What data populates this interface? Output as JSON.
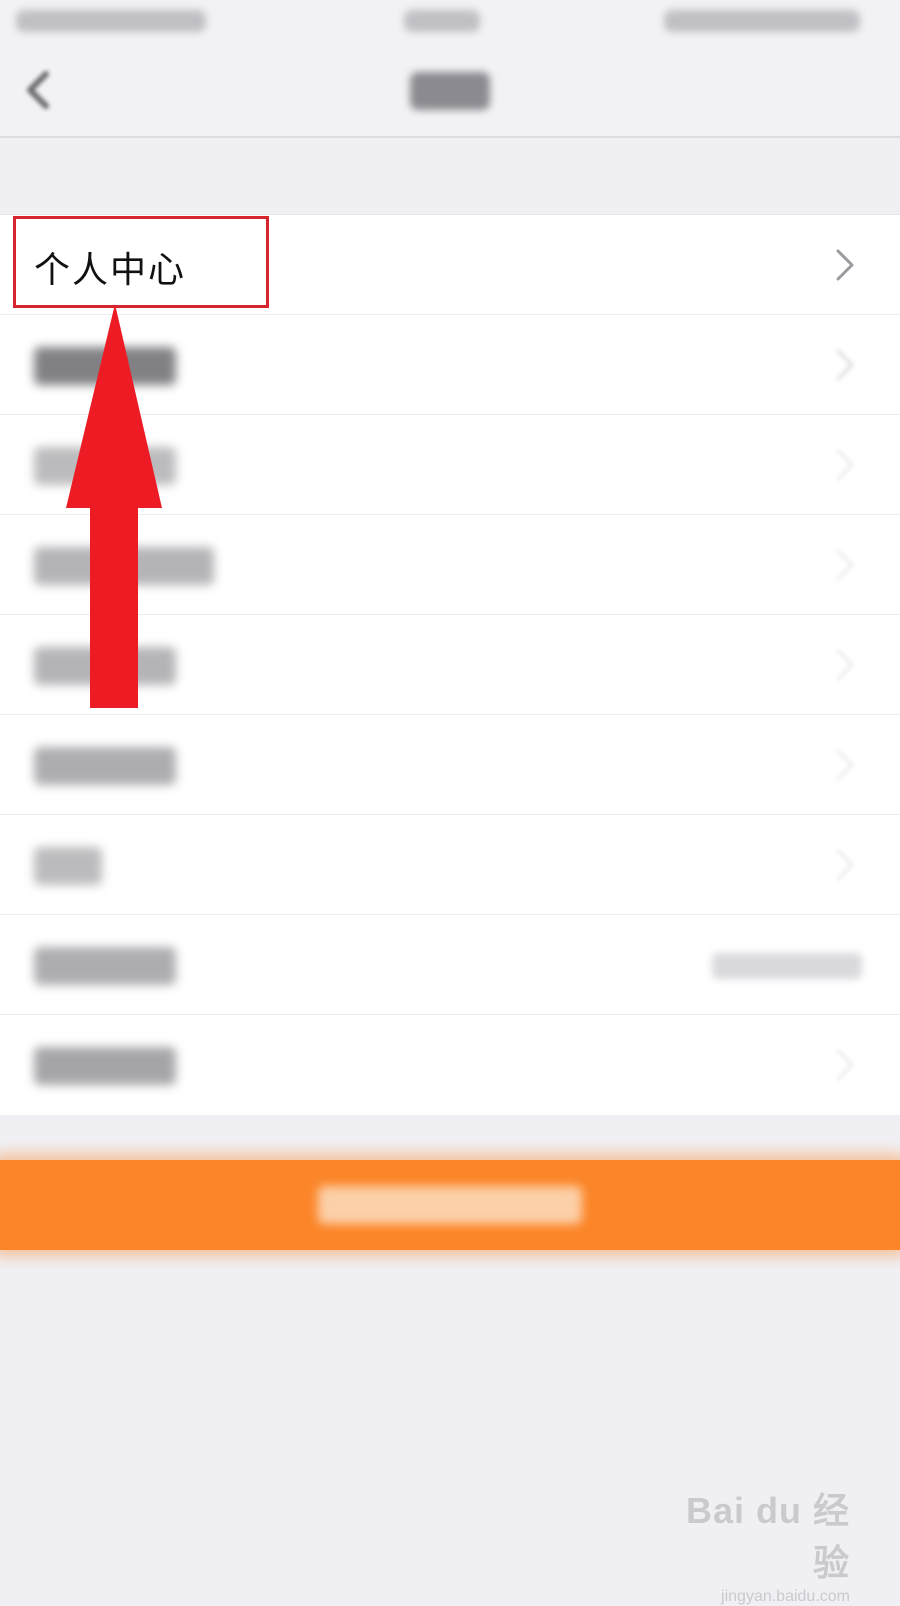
{
  "nav": {
    "back_icon": "chevron-left-icon"
  },
  "menu": {
    "items": [
      {
        "label": "个人中心",
        "icon": "chevron-right-icon"
      }
    ]
  },
  "annotation": {
    "color": "#d7252f",
    "arrow_color": "#ed1c24"
  },
  "logout": {
    "color": "#fb8528"
  },
  "watermark": {
    "logo": "Bai du 经验",
    "url": "jingyan.baidu.com"
  }
}
